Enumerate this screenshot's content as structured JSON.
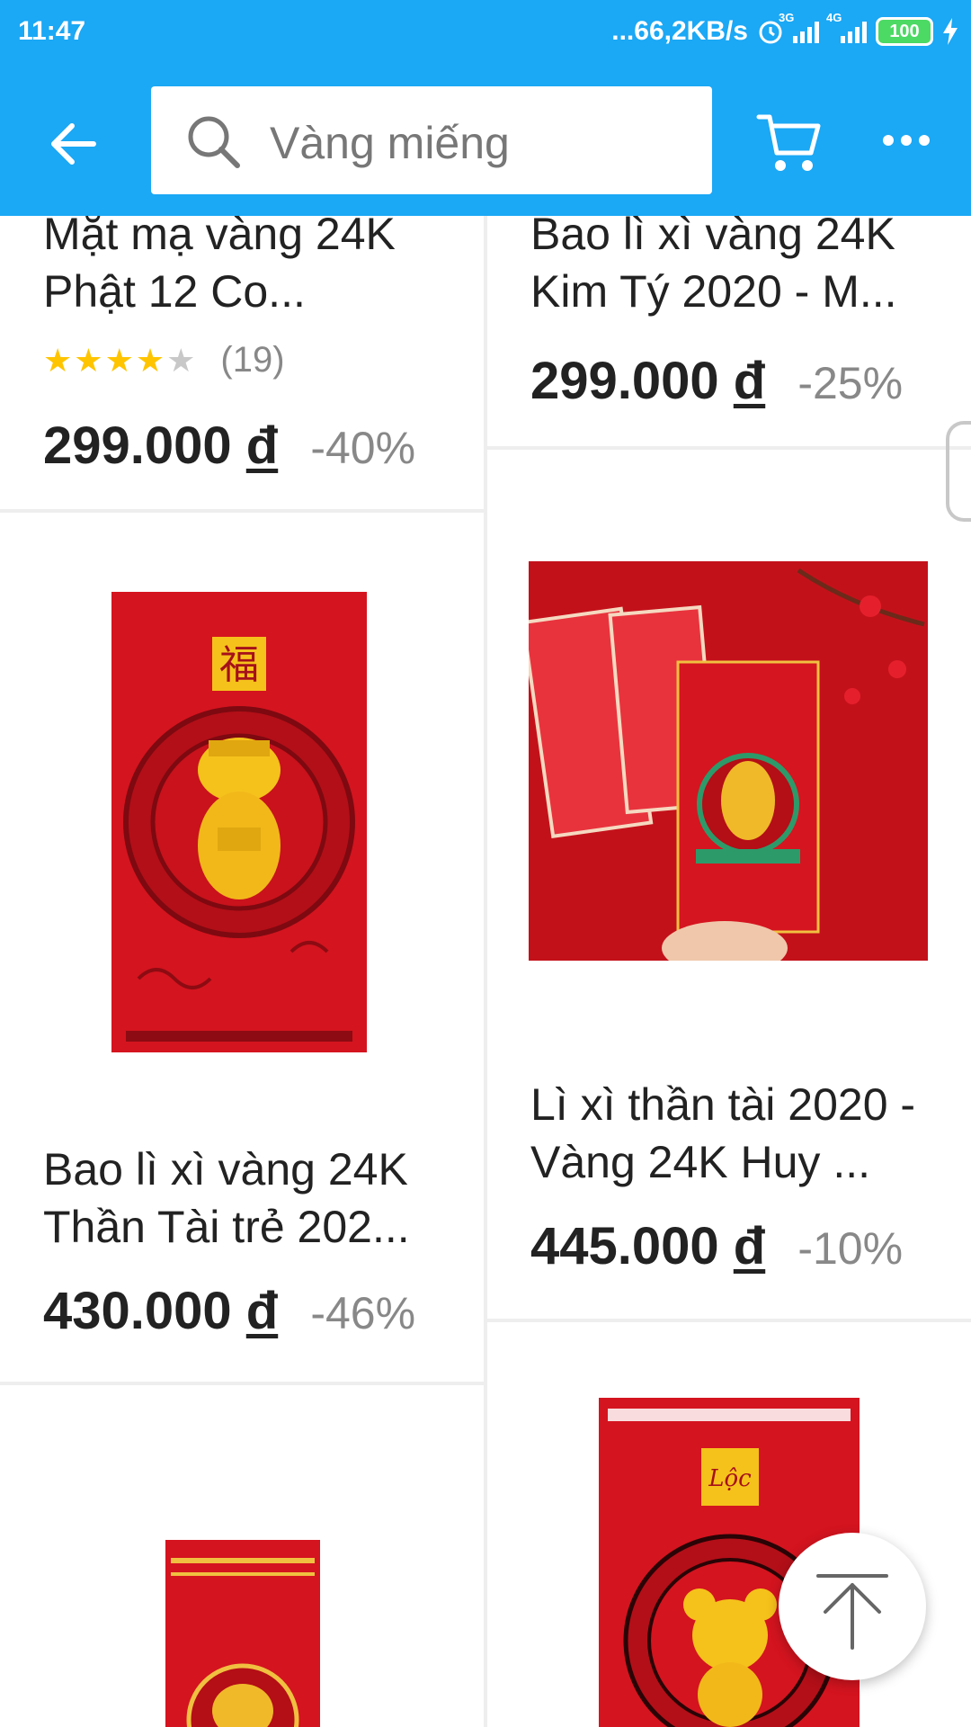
{
  "status_bar": {
    "time": "11:47",
    "network_speed": "...66,2KB/s",
    "net1": "3G",
    "net2": "4G",
    "battery": "100"
  },
  "header": {
    "search_placeholder": "Vàng miếng",
    "accent_color": "#1ba8f5"
  },
  "products": [
    {
      "name": "Mặt mạ vàng 24K Phật 12 Co...",
      "rating": 4,
      "max_rating": 5,
      "reviews": "(19)",
      "price": "299.000",
      "currency": "đ",
      "discount": "-40%"
    },
    {
      "name": "Bao lì xì vàng 24K Kim Tý 2020 - M...",
      "price": "299.000",
      "currency": "đ",
      "discount": "-25%"
    },
    {
      "name": "Bao lì xì vàng 24K Thần Tài trẻ 202...",
      "price": "430.000",
      "currency": "đ",
      "discount": "-46%"
    },
    {
      "name": "Lì xì thần tài 2020 - Vàng 24K Huy ...",
      "price": "445.000",
      "currency": "đ",
      "discount": "-10%"
    }
  ],
  "envelope_labels": {
    "fu": "福",
    "loc": "Lộc"
  },
  "colors": {
    "envelope_red": "#d4141f",
    "gold": "#f5c21b",
    "star": "#ffc400"
  }
}
